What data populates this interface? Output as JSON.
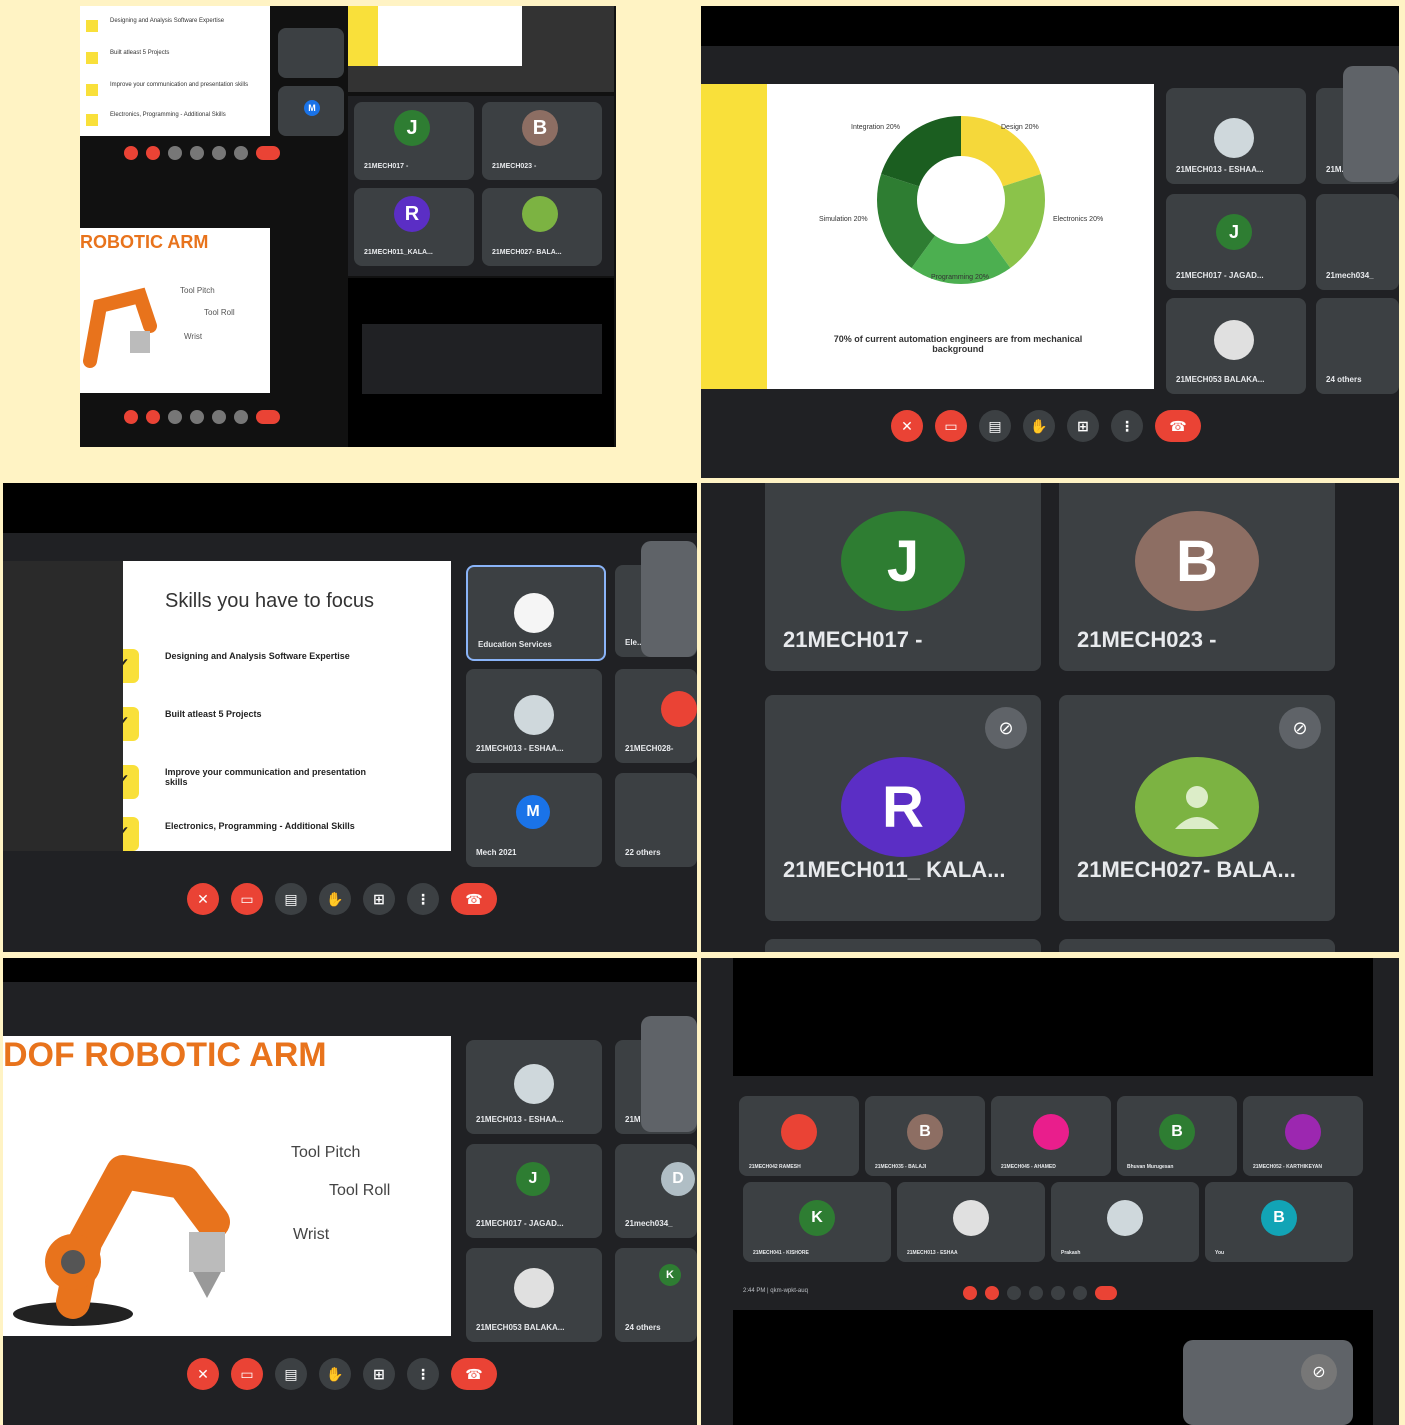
{
  "panel_a": {
    "skills_items": [
      "Designing and Analysis Software Expertise",
      "Built atleast 5 Projects",
      "Improve your communication and presentation skills",
      "Electronics, Programming - Additional Skills"
    ],
    "robot_title": "ROBOTIC ARM",
    "robot_labels": {
      "tool_pitch": "Tool Pitch",
      "tool_roll": "Tool Roll",
      "wrist": "Wrist"
    },
    "tiles": [
      {
        "initial": "J",
        "name": "21MECH017 -",
        "color": "#2e7d32"
      },
      {
        "initial": "B",
        "name": "21MECH023 -",
        "color": "#8d6e63"
      },
      {
        "initial": "R",
        "name": "21MECH011_KALA...",
        "color": "#5b2ec5"
      },
      {
        "initial": "",
        "name": "21MECH027- BALA...",
        "color": "#7cb342"
      }
    ]
  },
  "panel_b": {
    "chart_data": {
      "type": "pie",
      "title": "70% of current automation engineers are from mechanical background",
      "categories": [
        "Design",
        "Electronics",
        "Programming",
        "Simulation",
        "Integration"
      ],
      "values": [
        20,
        20,
        20,
        20,
        20
      ],
      "labels": [
        "Design 20%",
        "Electronics 20%",
        "Programming 20%",
        "Simulation 20%",
        "Integration 20%"
      ],
      "colors": [
        "#f5d83a",
        "#8bc34a",
        "#4caf50",
        "#2e7d32",
        "#1b5e20"
      ]
    },
    "tiles": [
      {
        "name": "21MECH013 - ESHAA..."
      },
      {
        "initial": "J",
        "name": "21MECH017 - JAGAD...",
        "color": "#2e7d32"
      },
      {
        "name": "21MECH053 BALAKA..."
      }
    ],
    "side_names": [
      "21M...",
      "21mech034_",
      "24 others"
    ]
  },
  "panel_c": {
    "slide_title": "Skills you have to focus",
    "skills_items": [
      "Designing and Analysis Software Expertise",
      "Built atleast 5 Projects",
      "Improve your communication and presentation skills",
      "Electronics, Programming - Additional Skills"
    ],
    "tiles": [
      {
        "name": "Education Services"
      },
      {
        "name": "21MECH013 - ESHAA..."
      },
      {
        "initial": "M",
        "name": "Mech 2021",
        "color": "#1a73e8"
      }
    ],
    "side_names": [
      "Ele...",
      "21MECH028-",
      "22 others"
    ]
  },
  "panel_d": {
    "tiles": [
      {
        "initial": "J",
        "name": "21MECH017 -",
        "color": "#2e7d32"
      },
      {
        "initial": "B",
        "name": "21MECH023 -",
        "color": "#8d6e63"
      },
      {
        "initial": "R",
        "name": "21MECH011_ KALA...",
        "color": "#5b2ec5"
      },
      {
        "initial": "",
        "name": "21MECH027- BALA...",
        "color": "#7cb342"
      }
    ]
  },
  "panel_e": {
    "slide_title": "DOF ROBOTIC ARM",
    "robot_labels": {
      "tool_pitch": "Tool Pitch",
      "tool_roll": "Tool Roll",
      "wrist": "Wrist"
    },
    "tiles": [
      {
        "name": "21MECH013 - ESHAA..."
      },
      {
        "initial": "J",
        "name": "21MECH017 - JAGAD...",
        "color": "#2e7d32"
      },
      {
        "name": "21MECH053 BALAKA..."
      }
    ],
    "side_names": [
      "21M...",
      "21mech034_",
      "24 others"
    ],
    "side_initials": [
      "D",
      "K"
    ]
  },
  "panel_f": {
    "row1": [
      {
        "initial": "",
        "name": "21MECH042 RAMESH",
        "color": "#ea4335"
      },
      {
        "initial": "B",
        "name": "21MECH035 - BALAJI",
        "color": "#8d6e63"
      },
      {
        "initial": "",
        "name": "21MECH045 - AHAMED",
        "color": "#e91e8c"
      },
      {
        "initial": "B",
        "name": "Bhuvan Murugesan",
        "color": "#2e7d32"
      },
      {
        "initial": "",
        "name": "21MECH052 - KARTHIKEYAN",
        "color": "#9c27b0"
      }
    ],
    "row2": [
      {
        "initial": "K",
        "name": "21MECH041 - KISHORE",
        "color": "#2e7d32"
      },
      {
        "initial": "",
        "name": "21MECH013 - ESHAA",
        "color": "#e0e0e0"
      },
      {
        "initial": "",
        "name": "Prakash",
        "color": "#cfd8dc"
      },
      {
        "initial": "B",
        "name": "You",
        "color": "#12a4b6"
      }
    ],
    "meeting_info": "2:44 PM  |  qkm-wpkt-auq"
  }
}
